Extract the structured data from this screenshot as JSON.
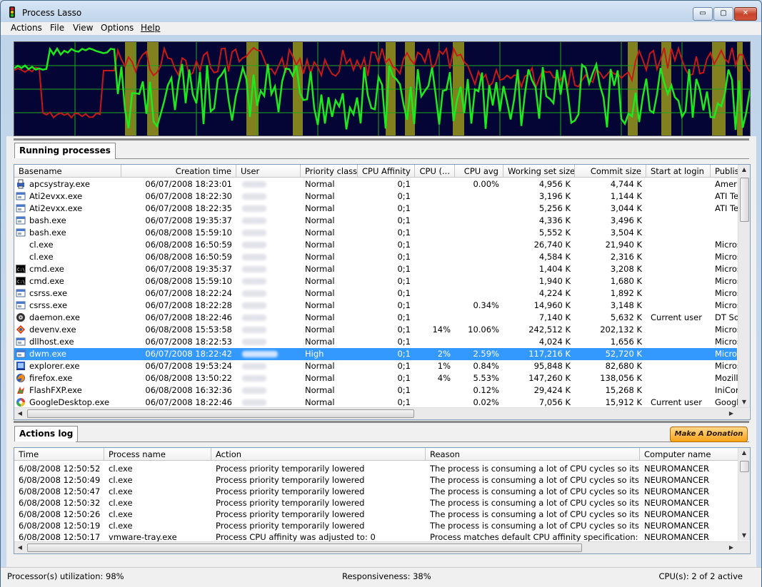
{
  "window": {
    "title": "Process Lasso",
    "minimize_glyph": "▭",
    "maximize_glyph": "▢",
    "close_glyph": "✕"
  },
  "menu": [
    "Actions",
    "File",
    "View",
    "Options",
    "Help"
  ],
  "graph": {
    "colors": {
      "background": "#040435",
      "grid": "#1fa81f",
      "cpu_line": "#1ee81e",
      "responsiveness_line": "#c81818",
      "highlight_band": "#8c8c1e"
    }
  },
  "processes_tab": {
    "label": "Running processes"
  },
  "process_columns": [
    "Basename",
    "Creation time",
    "User",
    "Priority class",
    "CPU Affinity",
    "CPU (...",
    "CPU avg",
    "Working set size",
    "Commit size",
    "Start at login",
    "Publis"
  ],
  "processes": [
    {
      "icon": "printer-icon",
      "basename": "apcsystray.exe",
      "created": "06/07/2008 18:23:01",
      "priority": "Normal",
      "affinity": "0;1",
      "cpu": "",
      "cpu_avg": "0.00%",
      "working_set": "4,956 K",
      "commit": "4,744 K",
      "start_login": "",
      "publisher": "Ameri"
    },
    {
      "icon": "window-icon",
      "basename": "Ati2evxx.exe",
      "created": "06/07/2008 18:22:30",
      "priority": "Normal",
      "affinity": "0;1",
      "cpu": "",
      "cpu_avg": "",
      "working_set": "3,196 K",
      "commit": "1,144 K",
      "start_login": "",
      "publisher": "ATI Te"
    },
    {
      "icon": "window-icon",
      "basename": "Ati2evxx.exe",
      "created": "06/07/2008 18:22:35",
      "priority": "Normal",
      "affinity": "0;1",
      "cpu": "",
      "cpu_avg": "",
      "working_set": "5,256 K",
      "commit": "3,044 K",
      "start_login": "",
      "publisher": "ATI Te"
    },
    {
      "icon": "window-icon",
      "basename": "bash.exe",
      "created": "06/07/2008 19:35:37",
      "priority": "Normal",
      "affinity": "0;1",
      "cpu": "",
      "cpu_avg": "",
      "working_set": "4,336 K",
      "commit": "3,496 K",
      "start_login": "",
      "publisher": ""
    },
    {
      "icon": "window-icon",
      "basename": "bash.exe",
      "created": "06/08/2008 15:59:10",
      "priority": "Normal",
      "affinity": "0;1",
      "cpu": "",
      "cpu_avg": "",
      "working_set": "5,552 K",
      "commit": "3,504 K",
      "start_login": "",
      "publisher": ""
    },
    {
      "icon": "",
      "basename": "cl.exe",
      "created": "06/08/2008 16:50:59",
      "priority": "Normal",
      "affinity": "0;1",
      "cpu": "",
      "cpu_avg": "",
      "working_set": "26,740 K",
      "commit": "21,940 K",
      "start_login": "",
      "publisher": "Micros"
    },
    {
      "icon": "",
      "basename": "cl.exe",
      "created": "06/08/2008 16:50:59",
      "priority": "Normal",
      "affinity": "0;1",
      "cpu": "",
      "cpu_avg": "",
      "working_set": "4,584 K",
      "commit": "2,316 K",
      "start_login": "",
      "publisher": "Micros"
    },
    {
      "icon": "console-icon",
      "basename": "cmd.exe",
      "created": "06/07/2008 19:35:37",
      "priority": "Normal",
      "affinity": "0;1",
      "cpu": "",
      "cpu_avg": "",
      "working_set": "1,404 K",
      "commit": "3,208 K",
      "start_login": "",
      "publisher": "Micros"
    },
    {
      "icon": "console-icon",
      "basename": "cmd.exe",
      "created": "06/08/2008 15:59:10",
      "priority": "Normal",
      "affinity": "0;1",
      "cpu": "",
      "cpu_avg": "",
      "working_set": "1,940 K",
      "commit": "1,680 K",
      "start_login": "",
      "publisher": "Micros"
    },
    {
      "icon": "window-icon",
      "basename": "csrss.exe",
      "created": "06/07/2008 18:22:24",
      "priority": "Normal",
      "affinity": "0;1",
      "cpu": "",
      "cpu_avg": "",
      "working_set": "4,224 K",
      "commit": "1,892 K",
      "start_login": "",
      "publisher": "Micros"
    },
    {
      "icon": "window-icon",
      "basename": "csrss.exe",
      "created": "06/07/2008 18:22:28",
      "priority": "Normal",
      "affinity": "0;1",
      "cpu": "",
      "cpu_avg": "0.34%",
      "working_set": "14,960 K",
      "commit": "3,148 K",
      "start_login": "",
      "publisher": "Micros"
    },
    {
      "icon": "daemon-icon",
      "basename": "daemon.exe",
      "created": "06/07/2008 18:22:46",
      "priority": "Normal",
      "affinity": "0;1",
      "cpu": "",
      "cpu_avg": "",
      "working_set": "7,140 K",
      "commit": "5,632 K",
      "start_login": "Current user",
      "publisher": "DT Sof"
    },
    {
      "icon": "devenv-icon",
      "basename": "devenv.exe",
      "created": "06/08/2008 15:53:58",
      "priority": "Normal",
      "affinity": "0;1",
      "cpu": "14%",
      "cpu_avg": "10.06%",
      "working_set": "242,512 K",
      "commit": "202,132 K",
      "start_login": "",
      "publisher": "Micros"
    },
    {
      "icon": "window-icon",
      "basename": "dllhost.exe",
      "created": "06/07/2008 18:22:53",
      "priority": "Normal",
      "affinity": "0;1",
      "cpu": "",
      "cpu_avg": "",
      "working_set": "4,024 K",
      "commit": "1,656 K",
      "start_login": "",
      "publisher": "Micros"
    },
    {
      "icon": "window-icon",
      "basename": "dwm.exe",
      "created": "06/07/2008 18:22:42",
      "priority": "High",
      "affinity": "0;1",
      "cpu": "2%",
      "cpu_avg": "2.59%",
      "working_set": "117,216 K",
      "commit": "52,720 K",
      "start_login": "",
      "publisher": "Micros",
      "selected": true
    },
    {
      "icon": "explorer-icon",
      "basename": "explorer.exe",
      "created": "06/07/2008 19:53:24",
      "priority": "Normal",
      "affinity": "0;1",
      "cpu": "1%",
      "cpu_avg": "0.84%",
      "working_set": "95,848 K",
      "commit": "82,680 K",
      "start_login": "",
      "publisher": "Micros"
    },
    {
      "icon": "firefox-icon",
      "basename": "firefox.exe",
      "created": "06/08/2008 13:50:22",
      "priority": "Normal",
      "affinity": "0;1",
      "cpu": "4%",
      "cpu_avg": "5.53%",
      "working_set": "147,260 K",
      "commit": "138,056 K",
      "start_login": "",
      "publisher": "Mozill"
    },
    {
      "icon": "flashfxp-icon",
      "basename": "FlashFXP.exe",
      "created": "06/08/2008 16:32:36",
      "priority": "Normal",
      "affinity": "0;1",
      "cpu": "",
      "cpu_avg": "0.12%",
      "working_set": "29,424 K",
      "commit": "15,268 K",
      "start_login": "",
      "publisher": "IniCor"
    },
    {
      "icon": "google-icon",
      "basename": "GoogleDesktop.exe",
      "created": "06/07/2008 18:22:46",
      "priority": "Normal",
      "affinity": "0;1",
      "cpu": "",
      "cpu_avg": "0.02%",
      "working_set": "7,056 K",
      "commit": "15,912 K",
      "start_login": "Current user",
      "publisher": "Googl"
    }
  ],
  "actions_tab": {
    "label": "Actions log"
  },
  "donate_button": "Make A Donation",
  "log_columns": [
    "Time",
    "Process name",
    "Action",
    "Reason",
    "Computer name"
  ],
  "log": [
    {
      "time": "6/08/2008 12:50:52",
      "process": "cl.exe",
      "action": "Process priority temporarily lowered",
      "reason": "The process is consuming a lot of CPU cycles so its p...",
      "computer": "NEUROMANCER"
    },
    {
      "time": "6/08/2008 12:50:49",
      "process": "cl.exe",
      "action": "Process priority temporarily lowered",
      "reason": "The process is consuming a lot of CPU cycles so its p...",
      "computer": "NEUROMANCER"
    },
    {
      "time": "6/08/2008 12:50:47",
      "process": "cl.exe",
      "action": "Process priority temporarily lowered",
      "reason": "The process is consuming a lot of CPU cycles so its p...",
      "computer": "NEUROMANCER"
    },
    {
      "time": "6/08/2008 12:50:32",
      "process": "cl.exe",
      "action": "Process priority temporarily lowered",
      "reason": "The process is consuming a lot of CPU cycles so its p...",
      "computer": "NEUROMANCER"
    },
    {
      "time": "6/08/2008 12:50:26",
      "process": "cl.exe",
      "action": "Process priority temporarily lowered",
      "reason": "The process is consuming a lot of CPU cycles so its p...",
      "computer": "NEUROMANCER"
    },
    {
      "time": "6/08/2008 12:50:19",
      "process": "cl.exe",
      "action": "Process priority temporarily lowered",
      "reason": "The process is consuming a lot of CPU cycles so its p...",
      "computer": "NEUROMANCER"
    },
    {
      "time": "6/08/2008 12:50:17",
      "process": "vmware-tray.exe",
      "action": "Process CPU affinity was adjusted to: 0",
      "reason": "Process matches default CPU affinity specification: v...",
      "computer": "NEUROMANCER"
    }
  ],
  "status": {
    "utilization": "Processor(s) utilization: 98%",
    "responsiveness": "Responsiveness: 38%",
    "cpus": "CPU(s): 2 of 2 active"
  }
}
